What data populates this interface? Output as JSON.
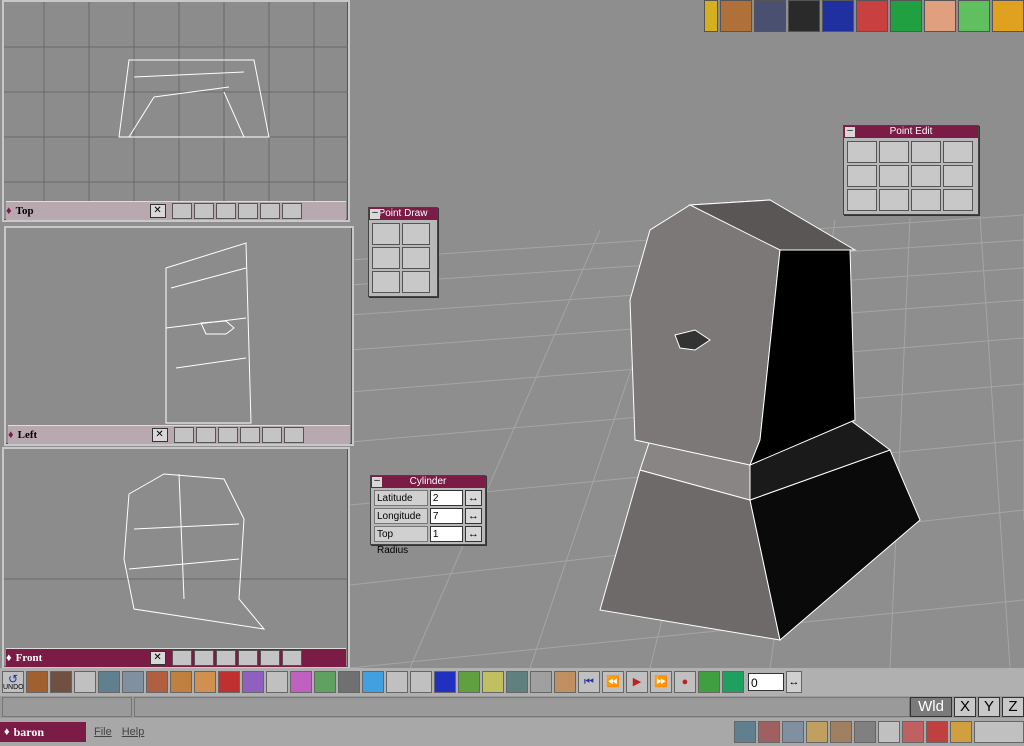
{
  "viewports": {
    "top": {
      "label": "Top"
    },
    "left": {
      "label": "Left"
    },
    "front": {
      "label": "Front"
    }
  },
  "close_glyph": "✕",
  "point_draw": {
    "title": "Point Draw"
  },
  "point_edit": {
    "title": "Point Edit"
  },
  "cylinder": {
    "title": "Cylinder",
    "fields": [
      {
        "label": "Latitude",
        "value": "2"
      },
      {
        "label": "Longitude",
        "value": "7"
      },
      {
        "label": "Top Radius",
        "value": "1"
      }
    ]
  },
  "toolbar": {
    "undo_label": "UNDO",
    "frame_value": "0",
    "wid_label": "Wld",
    "axis_x": "X",
    "axis_y": "Y",
    "axis_z": "Z"
  },
  "app": {
    "project_name": "baron",
    "menu_file": "File",
    "menu_help": "Help"
  },
  "top_icons": [
    "truespace-te2-icon",
    "acorn-icon",
    "cube-icon",
    "tire-icon",
    "logo-icon",
    "house-icon",
    "color-cube-icon",
    "bandage-icon",
    "sphere-icon",
    "dome-icon"
  ],
  "colors": {
    "active_bar": "#7a1c45",
    "inactive_bar": "#b8a8b0",
    "panel_header": "#7a1c45"
  }
}
